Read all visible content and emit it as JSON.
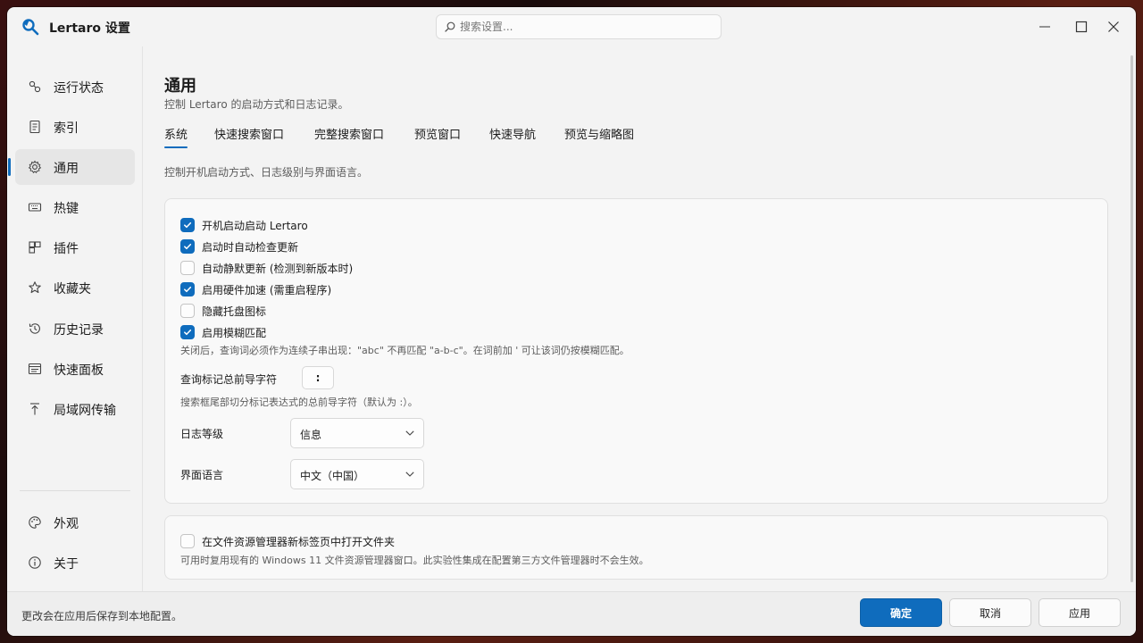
{
  "window": {
    "title": "Lertaro 设置"
  },
  "search": {
    "placeholder": "搜索设置..."
  },
  "sidebar": {
    "items": [
      {
        "label": "运行状态",
        "icon": "status-icon"
      },
      {
        "label": "索引",
        "icon": "index-icon"
      },
      {
        "label": "通用",
        "icon": "gear-icon",
        "active": true
      },
      {
        "label": "热键",
        "icon": "keyboard-icon"
      },
      {
        "label": "插件",
        "icon": "plugin-icon"
      },
      {
        "label": "收藏夹",
        "icon": "star-icon"
      },
      {
        "label": "历史记录",
        "icon": "history-icon"
      },
      {
        "label": "快速面板",
        "icon": "panel-icon"
      },
      {
        "label": "局域网传输",
        "icon": "upload-icon"
      }
    ],
    "bottom_items": [
      {
        "label": "外观",
        "icon": "palette-icon"
      },
      {
        "label": "关于",
        "icon": "info-icon"
      }
    ]
  },
  "main": {
    "title": "通用",
    "subtitle": "控制 Lertaro 的启动方式和日志记录。",
    "tabs": [
      {
        "label": "系统",
        "active": true
      },
      {
        "label": "快速搜索窗口"
      },
      {
        "label": "完整搜索窗口"
      },
      {
        "label": "预览窗口"
      },
      {
        "label": "快速导航"
      },
      {
        "label": "预览与缩略图"
      }
    ],
    "tab_description": "控制开机启动方式、日志级别与界面语言。",
    "options": [
      {
        "label": "开机启动启动 Lertaro",
        "checked": true
      },
      {
        "label": "启动时自动检查更新",
        "checked": true
      },
      {
        "label": "自动静默更新 (检测到新版本时)",
        "checked": false
      },
      {
        "label": "启用硬件加速 (需重启程序)",
        "checked": true
      },
      {
        "label": "隐藏托盘图标",
        "checked": false
      },
      {
        "label": "启用模糊匹配",
        "checked": true
      }
    ],
    "fuzzy_hint": "关闭后，查询词必须作为连续子串出现：\"abc\" 不再匹配 \"a-b-c\"。在词前加 ' 可让该词仍按模糊匹配。",
    "prefix": {
      "label": "查询标记总前导字符",
      "value": ":",
      "hint": "搜索框尾部切分标记表达式的总前导字符（默认为 :）。"
    },
    "log_level": {
      "label": "日志等级",
      "value": "信息"
    },
    "language": {
      "label": "界面语言",
      "value": "中文（中国）"
    },
    "explorer": {
      "label": "在文件资源管理器新标签页中打开文件夹",
      "checked": false,
      "hint": "可用时复用现有的 Windows 11 文件资源管理器窗口。此实验性集成在配置第三方文件管理器时不会生效。"
    }
  },
  "footer": {
    "text": "更改会在应用后保存到本地配置。",
    "ok_label": "确定",
    "cancel_label": "取消",
    "apply_label": "应用"
  },
  "colors": {
    "accent": "#0f6cbd",
    "window_bg": "#f3f3f3",
    "card_bg": "#f9f9f9"
  }
}
